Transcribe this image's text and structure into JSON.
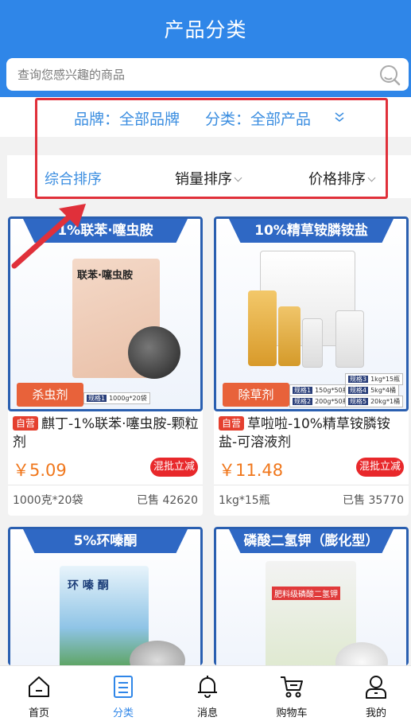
{
  "header": {
    "title": "产品分类"
  },
  "search": {
    "placeholder": "查询您感兴趣的商品"
  },
  "filters": {
    "brand_label": "品牌：全部品牌",
    "category_label": "分类：全部产品"
  },
  "sort": {
    "items": [
      "综合排序",
      "销量排序",
      "价格排序"
    ],
    "active_index": 0
  },
  "products": [
    {
      "banner": "1%联苯·噻虫胺",
      "pack_text": "联苯·噻虫胺",
      "tag": "杀虫剂",
      "specs": [
        [
          "规格1",
          "1000g*20袋"
        ]
      ],
      "badge": "自营",
      "title": "麒丁-1%联苯·噻虫胺-颗粒剂",
      "price": "￥5.09",
      "promo": "混批立减",
      "spec": "1000克*20袋",
      "sold": "已售 42620"
    },
    {
      "banner": "10%精草铵膦铵盐",
      "tag": "除草剂",
      "specs": [
        [
          "规格1",
          "150g*50瓶"
        ],
        [
          "规格2",
          "200g*50瓶"
        ],
        [
          "规格3",
          "1kg*15瓶"
        ],
        [
          "规格4",
          "5kg*4桶"
        ],
        [
          "规格5",
          "20kg*1桶"
        ]
      ],
      "badge": "自营",
      "title": "草啦啦-10%精草铵膦铵盐-可溶液剂",
      "price": "￥11.48",
      "promo": "混批立减",
      "spec": "1kg*15瓶",
      "sold": "已售 35770"
    },
    {
      "banner": "5%环嗪酮",
      "pack_text": "环 嗪 酮"
    },
    {
      "banner": "磷酸二氢钾（膨化型）",
      "pack_text": "肥料级磷酸二氢钾"
    }
  ],
  "nav": {
    "items": [
      "首页",
      "分类",
      "消息",
      "购物车",
      "我的"
    ],
    "active_index": 1
  },
  "colors": {
    "primary": "#2f86e8",
    "price": "#f0771c",
    "promo": "#e8282b",
    "highlight": "#e0303a"
  }
}
